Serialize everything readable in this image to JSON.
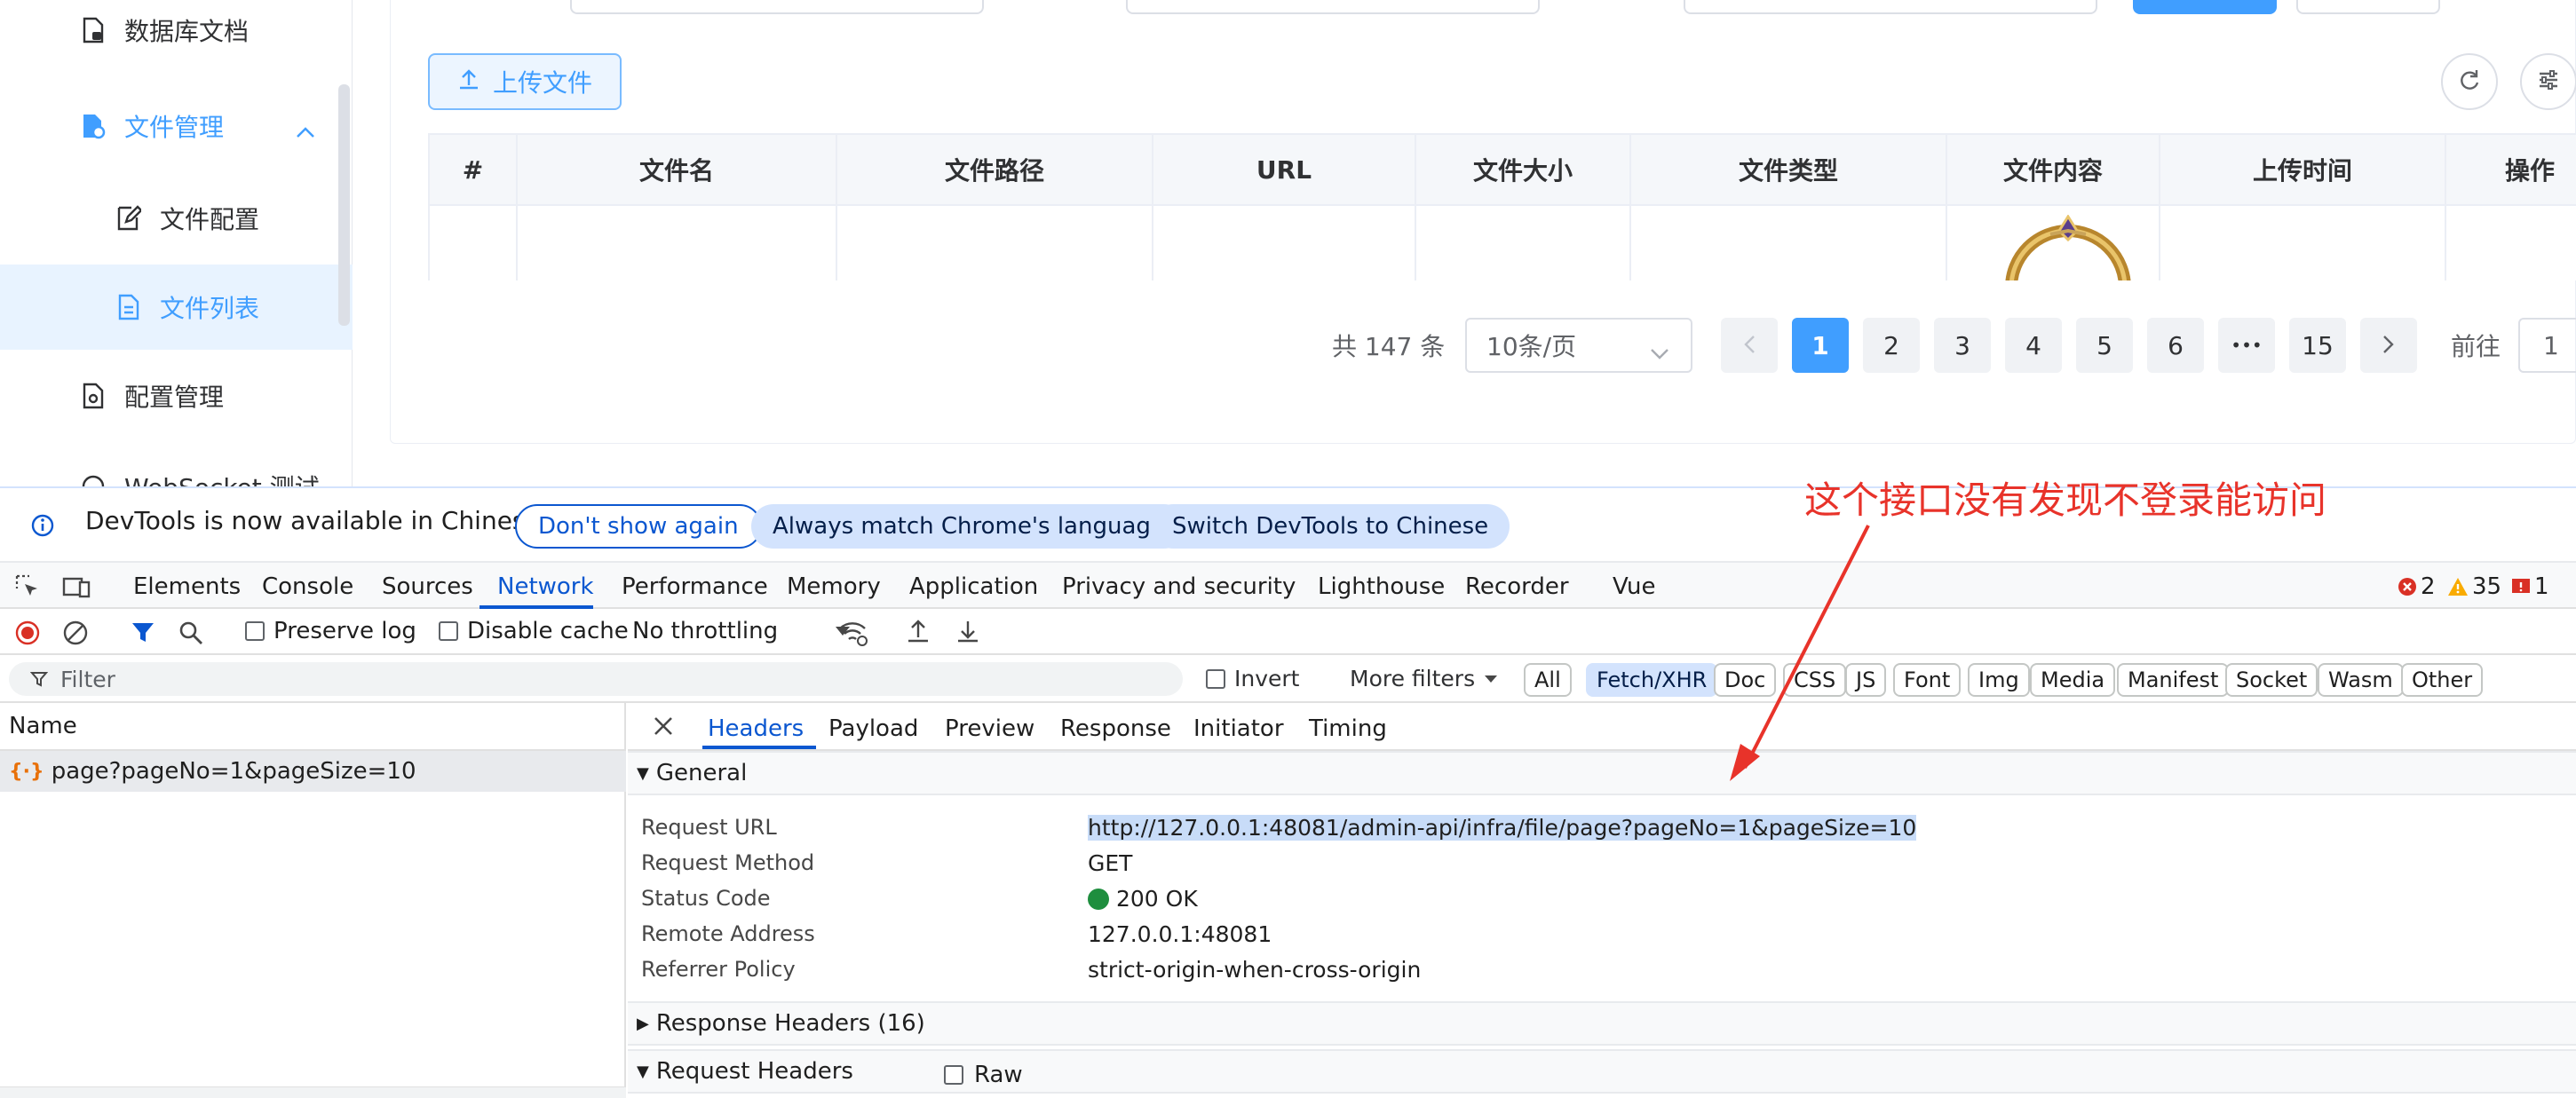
{
  "sidebar": {
    "items": [
      {
        "label": "数据库文档"
      },
      {
        "label": "文件管理"
      },
      {
        "label": "文件配置"
      },
      {
        "label": "文件列表"
      },
      {
        "label": "配置管理"
      },
      {
        "label": "WebSocket 测试"
      }
    ]
  },
  "toolbar": {
    "upload_label": "上传文件"
  },
  "table": {
    "headers": [
      "#",
      "文件名",
      "文件路径",
      "URL",
      "文件大小",
      "文件类型",
      "文件内容",
      "上传时间",
      "操作"
    ]
  },
  "pagination": {
    "total": "共 147 条",
    "page_size": "10条/页",
    "pages": [
      "1",
      "2",
      "3",
      "4",
      "5",
      "6",
      "•••",
      "15"
    ],
    "current": "1",
    "goto_label": "前往",
    "goto_value": "1"
  },
  "devtools": {
    "info_bar": {
      "text": "DevTools is now available in Chinese",
      "dont_show": "Don't show again",
      "always_match": "Always match Chrome's language",
      "switch": "Switch DevTools to Chinese"
    },
    "tabs": [
      "Elements",
      "Console",
      "Sources",
      "Network",
      "Performance",
      "Memory",
      "Application",
      "Privacy and security",
      "Lighthouse",
      "Recorder",
      "Vue"
    ],
    "counts": {
      "errors": "2",
      "warnings": "35",
      "issues": "1"
    },
    "toolbar": {
      "preserve_log": "Preserve log",
      "disable_cache": "Disable cache",
      "throttling": "No throttling"
    },
    "filter": {
      "placeholder": "Filter",
      "invert": "Invert",
      "more_filters": "More filters",
      "chips": [
        "All",
        "Fetch/XHR",
        "Doc",
        "CSS",
        "JS",
        "Font",
        "Img",
        "Media",
        "Manifest",
        "Socket",
        "Wasm",
        "Other"
      ]
    },
    "name_header": "Name",
    "request_name": "page?pageNo=1&pageSize=10",
    "detail_tabs": [
      "Headers",
      "Payload",
      "Preview",
      "Response",
      "Initiator",
      "Timing"
    ],
    "general": {
      "title": "General",
      "rows": [
        {
          "key": "Request URL",
          "value": "http://127.0.0.1:48081/admin-api/infra/file/page?pageNo=1&pageSize=10"
        },
        {
          "key": "Request Method",
          "value": "GET"
        },
        {
          "key": "Status Code",
          "value": "200 OK"
        },
        {
          "key": "Remote Address",
          "value": "127.0.0.1:48081"
        },
        {
          "key": "Referrer Policy",
          "value": "strict-origin-when-cross-origin"
        }
      ]
    },
    "response_headers": "Response Headers (16)",
    "request_headers": "Request Headers",
    "raw_label": "Raw"
  },
  "annotation": {
    "text": "这个接口没有发现不登录能访问",
    "color": "#e8332a"
  },
  "colors": {
    "accent": "#409eff",
    "devtools_blue": "#0b57d0",
    "status_ok": "#1e8e3e",
    "error": "#d93025",
    "warning": "#f9ab00"
  }
}
